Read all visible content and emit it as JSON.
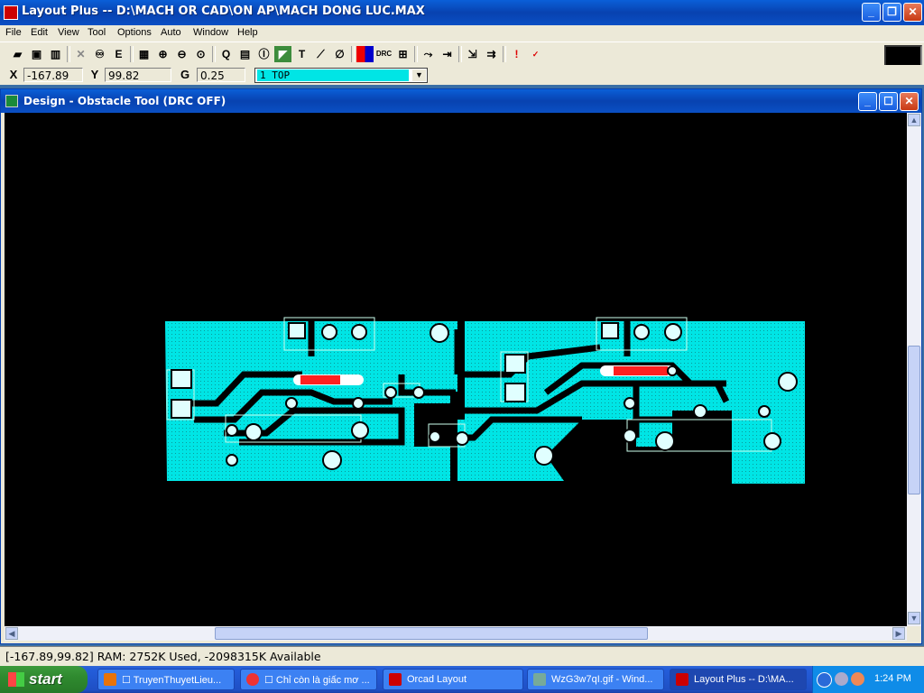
{
  "app": {
    "title": "Layout Plus -- D:\\MACH OR CAD\\ON AP\\MACH DONG LUC.MAX"
  },
  "menu": [
    "File",
    "Edit",
    "View",
    "Tool",
    "Options",
    "Auto",
    "Window",
    "Help"
  ],
  "coords": {
    "x_label": "X",
    "x": "-167.89",
    "y_label": "Y",
    "y": "99.82",
    "g_label": "G",
    "g": "0.25",
    "layer": "1  TOP"
  },
  "child": {
    "title": "Design - Obstacle Tool (DRC OFF)"
  },
  "status": {
    "text": "[-167.89,99.82]   RAM: 2752K Used, -2098315K Available"
  },
  "taskbar": {
    "start": "start",
    "tasks": [
      "☐ TruyenThuyetLieu...",
      "☐ Chỉ còn là giấc mơ ...",
      "Orcad Layout",
      "WzG3w7qI.gif - Wind...",
      "Layout Plus -- D:\\MA..."
    ],
    "clock": "1:24 PM"
  },
  "colors": {
    "copper": "#00e5e5",
    "board": "#000000",
    "highlight": "#ff2020"
  }
}
